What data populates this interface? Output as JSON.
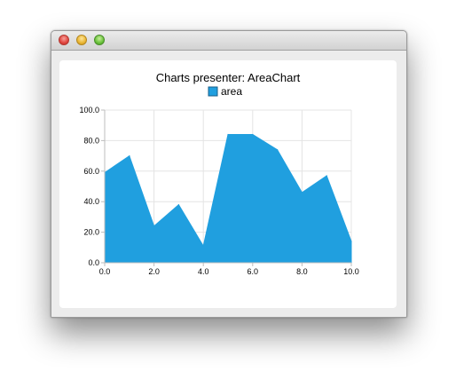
{
  "window": {
    "title": ""
  },
  "chart_data": {
    "type": "area",
    "title": "Charts presenter: AreaChart",
    "legend": {
      "entries": [
        "area"
      ],
      "placement": "top"
    },
    "xlabel": "",
    "ylabel": "",
    "xlim": [
      0,
      10
    ],
    "ylim": [
      0,
      100
    ],
    "grid": true,
    "x_ticks": [
      "0.0",
      "2.0",
      "4.0",
      "6.0",
      "8.0",
      "10.0"
    ],
    "y_ticks": [
      "0.0",
      "20.0",
      "40.0",
      "60.0",
      "80.0",
      "100.0"
    ],
    "series": [
      {
        "name": "area",
        "color": "#209fdf",
        "x": [
          0,
          1,
          2,
          3,
          4,
          5,
          6,
          7,
          8,
          9,
          10
        ],
        "y": [
          59,
          70,
          24,
          38,
          11,
          84,
          84,
          74,
          46,
          57,
          14
        ]
      }
    ]
  }
}
